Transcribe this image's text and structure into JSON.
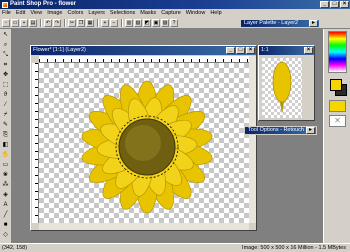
{
  "window": {
    "title": "Paint Shop Pro - flower"
  },
  "menu": {
    "items": [
      "File",
      "Edit",
      "View",
      "Image",
      "Colors",
      "Layers",
      "Selections",
      "Masks",
      "Capture",
      "Window",
      "Help"
    ]
  },
  "document": {
    "title": "Flower* [1:1] (Layer2)"
  },
  "layer_palette": {
    "title": "Layer Palette - Layer2"
  },
  "overview": {
    "title": "1:1"
  },
  "tool_options": {
    "title": "Tool Options - Retouch"
  },
  "colors": {
    "foreground": "#f7d600",
    "background": "#2a2a2a",
    "accent_title": "#0a246a",
    "petal": "#e8c400",
    "petal_dark": "#b89500",
    "center": "#6f5f10"
  },
  "status": {
    "coords": "(342, 158)",
    "image_info": "Image:  500 x 500 x 16 Million  -  1.5 MBytes"
  }
}
